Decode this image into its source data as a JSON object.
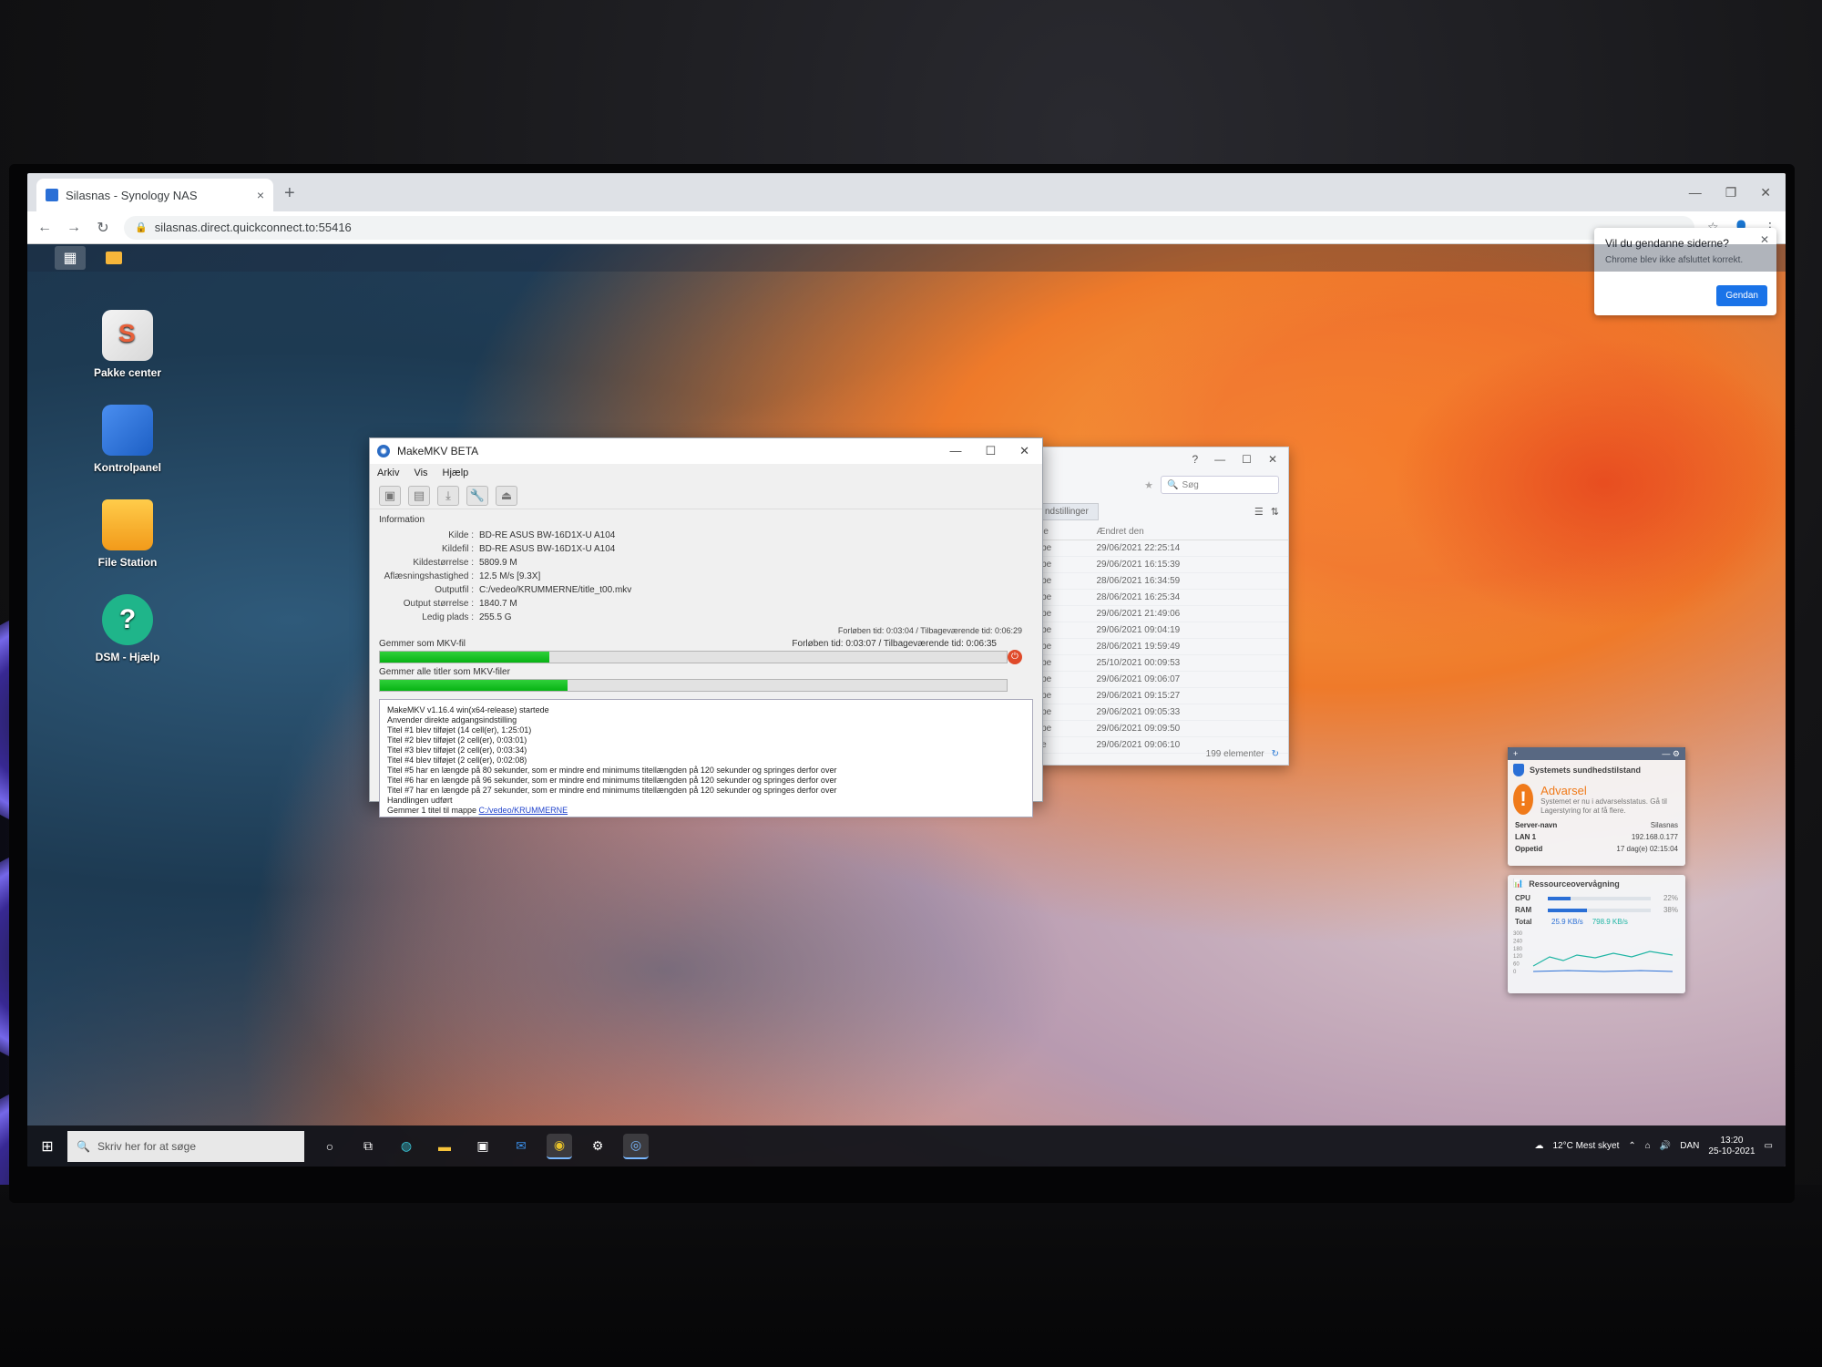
{
  "browser": {
    "tab_title": "Silasnas - Synology NAS",
    "tab_close": "×",
    "new_tab": "+",
    "url": "silasnas.direct.quickconnect.to:55416",
    "restore_popup": {
      "title": "Vil du gendanne siderne?",
      "body": "Chrome blev ikke afsluttet korrekt.",
      "button": "Gendan"
    }
  },
  "desktop_icons": [
    {
      "label": "Pakke center",
      "icon": "package-center-icon"
    },
    {
      "label": "Kontrolpanel",
      "icon": "control-panel-icon"
    },
    {
      "label": "File Station",
      "icon": "folder-icon"
    },
    {
      "label": "DSM - Hjælp",
      "icon": "help-icon"
    }
  ],
  "file_station": {
    "search_placeholder": "Søg",
    "settings_tab": "ndstillinger",
    "col_type": "type",
    "col_modified": "Ændret den",
    "rows": [
      {
        "type": "appe",
        "modified": "29/06/2021 22:25:14"
      },
      {
        "type": "appe",
        "modified": "29/06/2021 16:15:39"
      },
      {
        "type": "appe",
        "modified": "28/06/2021 16:34:59"
      },
      {
        "type": "appe",
        "modified": "28/06/2021 16:25:34"
      },
      {
        "type": "appe",
        "modified": "29/06/2021 21:49:06"
      },
      {
        "type": "appe",
        "modified": "29/06/2021 09:04:19"
      },
      {
        "type": "appe",
        "modified": "28/06/2021 19:59:49"
      },
      {
        "type": "appe",
        "modified": "25/10/2021 00:09:53"
      },
      {
        "type": "appe",
        "modified": "29/06/2021 09:06:07"
      },
      {
        "type": "appe",
        "modified": "29/06/2021 09:15:27"
      },
      {
        "type": "appe",
        "modified": "29/06/2021 09:05:33"
      },
      {
        "type": "appe",
        "modified": "29/06/2021 09:09:50"
      },
      {
        "type": "ppe",
        "modified": "29/06/2021 09:06:10"
      }
    ],
    "item_count": "199 elementer"
  },
  "makemkv": {
    "title": "MakeMKV BETA",
    "menu": [
      "Arkiv",
      "Vis",
      "Hjælp"
    ],
    "info_header": "Information",
    "info": [
      {
        "label": "Kilde :",
        "value": "BD-RE ASUS BW-16D1X-U A104"
      },
      {
        "label": "Kildefil :",
        "value": "BD-RE ASUS BW-16D1X-U A104"
      },
      {
        "label": "Kildestørrelse :",
        "value": "5809.9 M"
      },
      {
        "label": "Aflæsningshastighed :",
        "value": "12.5 M/s [9.3X]"
      },
      {
        "label": "Outputfil :",
        "value": "C:/vedeo/KRUMMERNE/title_t00.mkv"
      },
      {
        "label": "Output størrelse :",
        "value": "1840.7 M"
      },
      {
        "label": "Ledig plads :",
        "value": "255.5 G"
      }
    ],
    "time_total": "Forløben tid: 0:03:04 / Tilbageværende tid: 0:06:29",
    "progress1_label": "Gemmer som MKV-fil",
    "progress1_time": "Forløben tid: 0:03:07 / Tilbageværende tid: 0:06:35",
    "progress1_fraction": 0.27,
    "progress2_label": "Gemmer alle titler som MKV-filer",
    "progress2_fraction": 0.3,
    "log": [
      "MakeMKV v1.16.4 win(x64-release) startede",
      "Anvender direkte adgangsindstilling",
      "Titel #1 blev tilføjet (14 cell(er), 1:25:01)",
      "Titel #2 blev tilføjet (2 cell(er), 0:03:01)",
      "Titel #3 blev tilføjet (2 cell(er), 0:03:34)",
      "Titel #4 blev tilføjet (2 cell(er), 0:02:08)",
      "Titel #5 har en længde på 80 sekunder, som er mindre end minimums titellængden på 120 sekunder og springes derfor over",
      "Titel #6 har en længde på 96 sekunder, som er mindre end minimums titellængden på 120 sekunder og springes derfor over",
      "Titel #7 har en længde på 27 sekunder, som er mindre end minimums titellængden på 120 sekunder og springes derfor over",
      "Handlingen udført"
    ],
    "log_last_prefix": "Gemmer 1 titel til mappe ",
    "log_last_link": "C:/vedeo/KRUMMERNE"
  },
  "health_widget": {
    "title": "Systemets sundhedstilstand",
    "status": "Advarsel",
    "message": "Systemet er nu i advarselsstatus. Gå til Lagerstyring for at få flere.",
    "server_label": "Server-navn",
    "server_value": "Silasnas",
    "lan_label": "LAN 1",
    "lan_value": "192.168.0.177",
    "uptime_label": "Oppetid",
    "uptime_value": "17 dag(e) 02:15:04"
  },
  "resource_widget": {
    "title": "Ressourceovervågning",
    "cpu_label": "CPU",
    "cpu_pct": "22%",
    "cpu_fraction": 0.22,
    "ram_label": "RAM",
    "ram_pct": "38%",
    "ram_fraction": 0.38,
    "total_label": "Total",
    "net_up": "25.9 KB/s",
    "net_down": "798.9 KB/s",
    "y_ticks": [
      "300",
      "240",
      "180",
      "120",
      "60",
      "0"
    ]
  },
  "win_taskbar": {
    "search_placeholder": "Skriv her for at søge",
    "weather": "12°C  Mest skyet",
    "lang": "DAN",
    "time": "13:20",
    "date": "25-10-2021"
  },
  "colors": {
    "progress_green": "#07b314",
    "warning_orange": "#f07a1a",
    "chrome_blue": "#1a73e8"
  }
}
